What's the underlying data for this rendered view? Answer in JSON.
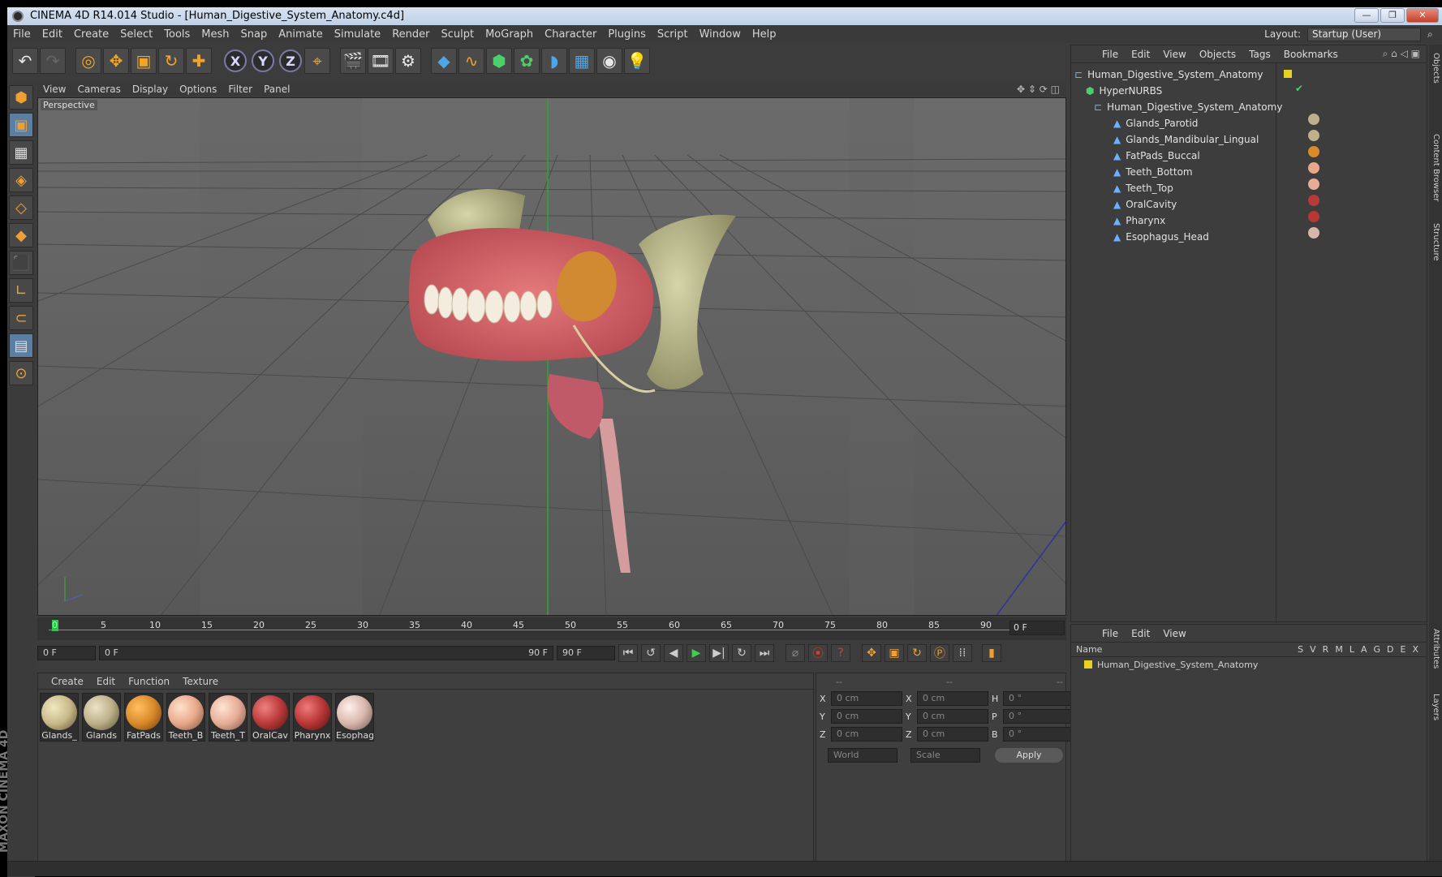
{
  "title": "CINEMA 4D R14.014 Studio - [Human_Digestive_System_Anatomy.c4d]",
  "menu": [
    "File",
    "Edit",
    "Create",
    "Select",
    "Tools",
    "Mesh",
    "Snap",
    "Animate",
    "Simulate",
    "Render",
    "Sculpt",
    "MoGraph",
    "Character",
    "Plugins",
    "Script",
    "Window",
    "Help"
  ],
  "layout_label": "Layout:",
  "layout_value": "Startup (User)",
  "viewport_menu": [
    "View",
    "Cameras",
    "Display",
    "Options",
    "Filter",
    "Panel"
  ],
  "viewport_label": "Perspective",
  "timeline": {
    "ticks": [
      "0",
      "5",
      "10",
      "15",
      "20",
      "25",
      "30",
      "35",
      "40",
      "45",
      "50",
      "55",
      "60",
      "65",
      "70",
      "75",
      "80",
      "85",
      "90"
    ],
    "current_frame": "0 F"
  },
  "transport": {
    "start": "0 F",
    "range_start": "0 F",
    "range_end": "90 F",
    "end": "90 F"
  },
  "material_menu": [
    "Create",
    "Edit",
    "Function",
    "Texture"
  ],
  "materials": [
    {
      "name": "Glands_",
      "color": "#c9b98a"
    },
    {
      "name": "Glands",
      "color": "#bdb08a"
    },
    {
      "name": "FatPads",
      "color": "#d98a2a"
    },
    {
      "name": "Teeth_B",
      "color": "#e8a98a"
    },
    {
      "name": "Teeth_T",
      "color": "#e6ad96"
    },
    {
      "name": "OralCav",
      "color": "#b93a3a"
    },
    {
      "name": "Pharynx",
      "color": "#b83636"
    },
    {
      "name": "Esophag",
      "color": "#d9b6ac"
    }
  ],
  "coords": {
    "headers": [
      "--",
      "--",
      "--"
    ],
    "rows": [
      [
        "X",
        "0 cm",
        "X",
        "0 cm",
        "H",
        "0 °"
      ],
      [
        "Y",
        "0 cm",
        "Y",
        "0 cm",
        "P",
        "0 °"
      ],
      [
        "Z",
        "0 cm",
        "Z",
        "0 cm",
        "B",
        "0 °"
      ]
    ],
    "mode1": "World",
    "mode2": "Scale",
    "apply": "Apply"
  },
  "objects_menu": [
    "File",
    "Edit",
    "View",
    "Objects",
    "Tags",
    "Bookmarks"
  ],
  "objects": [
    "Human_Digestive_System_Anatomy",
    "HyperNURBS",
    "Human_Digestive_System_Anatomy",
    "Glands_Parotid",
    "Glands_Mandibular_Lingual",
    "FatPads_Buccal",
    "Teeth_Bottom",
    "Teeth_Top",
    "OralCavity",
    "Pharynx",
    "Esophagus_Head"
  ],
  "attr_menu": [
    "File",
    "Edit",
    "View"
  ],
  "attr_cols": {
    "name": "Name",
    "flags": [
      "S",
      "V",
      "R",
      "M",
      "L",
      "A",
      "G",
      "D",
      "E",
      "X"
    ]
  },
  "attr_row": "Human_Digestive_System_Anatomy",
  "side_tabs": [
    "Objects",
    "Content Browser",
    "Structure",
    "Attributes",
    "Layers"
  ],
  "brand": "MAXON CINEMA 4D"
}
